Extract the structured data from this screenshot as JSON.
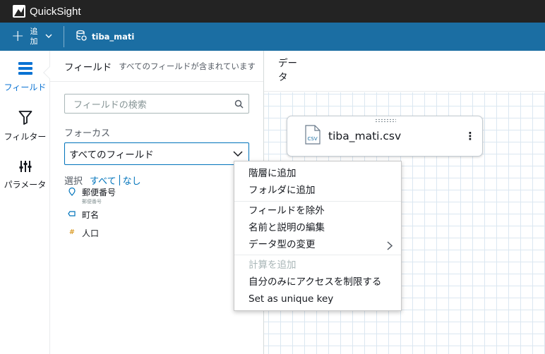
{
  "app": {
    "brand": "QuickSight"
  },
  "toolbar": {
    "add_label": "追加",
    "dataset_name": "tiba_mati"
  },
  "nav": [
    {
      "label": "フィールド",
      "icon": "fields-icon"
    },
    {
      "label": "フィルター",
      "icon": "filter-icon"
    },
    {
      "label": "パラメータ",
      "icon": "parameters-icon"
    }
  ],
  "fields_panel": {
    "title": "フィールド",
    "subtitle": "すべてのフィールドが含まれています",
    "search_placeholder": "フィールドの検索",
    "focus_label": "フォーカス",
    "focus_value": "すべてのフィールド",
    "select_label": "選択",
    "select_all": "すべて",
    "select_none": "なし",
    "fields": [
      {
        "name": "郵便番号",
        "sub": "郵便番号",
        "icon": "location-icon"
      },
      {
        "name": "町名",
        "sub": "",
        "icon": "text-field-icon"
      },
      {
        "name": "人口",
        "sub": "",
        "icon": "number-field-icon"
      }
    ]
  },
  "canvas": {
    "label": "データ",
    "card_name": "tiba_mati.csv",
    "card_icon_text": "CSV"
  },
  "context_menu": {
    "items": [
      {
        "label": "階層に追加",
        "enabled": true
      },
      {
        "label": "フォルダに追加",
        "enabled": true
      },
      {
        "label": "フィールドを除外",
        "enabled": true
      },
      {
        "label": "名前と説明の編集",
        "enabled": true
      },
      {
        "label": "データ型の変更",
        "enabled": true
      },
      {
        "label": "計算を追加",
        "enabled": false
      },
      {
        "label": "自分のみにアクセスを制限する",
        "enabled": true
      },
      {
        "label": "Set as unique key",
        "enabled": true
      }
    ]
  },
  "colors": {
    "topbar": "#232323",
    "toolbar": "#1b6ea3",
    "accent": "#0073bb",
    "grid": "#dbe7f1"
  }
}
